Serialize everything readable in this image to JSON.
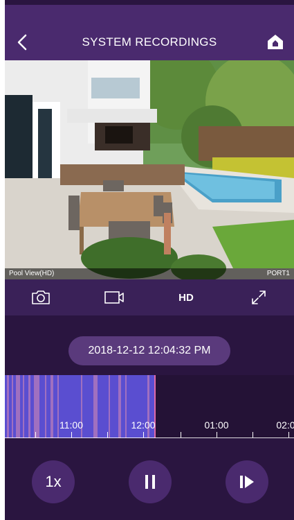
{
  "header": {
    "title": "SYSTEM RECORDINGS",
    "back_icon": "chevron-left-icon",
    "home_icon": "home-icon"
  },
  "video": {
    "camera_name": "Pool View(HD)",
    "port": "PORT1"
  },
  "controls": {
    "snapshot_icon": "camera-icon",
    "record_icon": "video-camera-icon",
    "quality_label": "HD",
    "fullscreen_icon": "expand-icon"
  },
  "timestamp": "2018-12-12 12:04:32 PM",
  "timeline": {
    "labels": [
      "11:00",
      "12:00",
      "01:00",
      "02:0"
    ],
    "recorded_color": "#5a4ed0",
    "event_color": "#a070c0",
    "cursor_color": "#e06aa8"
  },
  "playback": {
    "speed_label": "1x",
    "pause_icon": "pause-icon",
    "step_icon": "step-forward-icon"
  },
  "colors": {
    "header_bg": "#4a2a6e",
    "app_bg": "#2a1540",
    "controls_bg": "#3a2158",
    "pill_bg": "#5a3a7c"
  }
}
